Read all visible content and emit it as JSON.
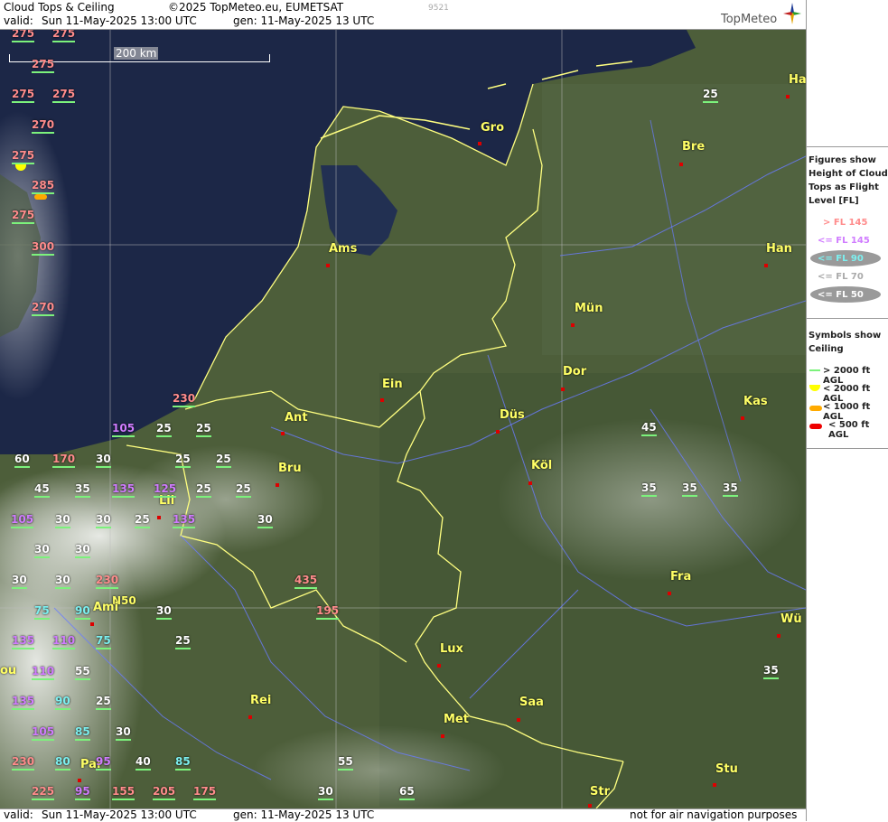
{
  "header": {
    "title": "Cloud Tops & Ceiling",
    "copyright": "©2025 TopMeteo.eu, EUMETSAT",
    "code": "9521",
    "valid_label": "valid:",
    "valid_time": "Sun  11-May-2025  13:00 UTC",
    "gen_time": "gen: 11-May-2025 13 UTC",
    "brand": "TopMeteo"
  },
  "footer": {
    "valid_label": "valid:",
    "valid_time": "Sun  11-May-2025  13:00 UTC",
    "gen_time": "gen: 11-May-2025 13 UTC",
    "disclaimer": "not for air navigation purposes"
  },
  "map": {
    "scale_label": "200 km",
    "region_label": "N50",
    "cities": [
      {
        "name": "Gro"
      },
      {
        "name": "Bre"
      },
      {
        "name": "Ha"
      },
      {
        "name": "Ams"
      },
      {
        "name": "Han"
      },
      {
        "name": "Mün"
      },
      {
        "name": "Dor"
      },
      {
        "name": "Ein"
      },
      {
        "name": "Ant"
      },
      {
        "name": "Düs"
      },
      {
        "name": "Kas"
      },
      {
        "name": "Bru"
      },
      {
        "name": "Köl"
      },
      {
        "name": "Lil"
      },
      {
        "name": "Ami"
      },
      {
        "name": "Fra"
      },
      {
        "name": "Wü"
      },
      {
        "name": "Lux"
      },
      {
        "name": "Rei"
      },
      {
        "name": "Saa"
      },
      {
        "name": "Met"
      },
      {
        "name": "Stu"
      },
      {
        "name": "Par"
      },
      {
        "name": "Str"
      },
      {
        "name": "ou"
      }
    ],
    "flight_levels": [
      {
        "v": "275",
        "c": "pink"
      },
      {
        "v": "275",
        "c": "pink"
      },
      {
        "v": "275",
        "c": "pink"
      },
      {
        "v": "275",
        "c": "pink"
      },
      {
        "v": "275",
        "c": "pink"
      },
      {
        "v": "270",
        "c": "pink"
      },
      {
        "v": "275",
        "c": "pink"
      },
      {
        "v": "285",
        "c": "pink"
      },
      {
        "v": "275",
        "c": "pink"
      },
      {
        "v": "300",
        "c": "pink"
      },
      {
        "v": "270",
        "c": "pink"
      },
      {
        "v": "25",
        "c": "white"
      },
      {
        "v": "230",
        "c": "pink"
      },
      {
        "v": "105",
        "c": "purple"
      },
      {
        "v": "25",
        "c": "white"
      },
      {
        "v": "25",
        "c": "white"
      },
      {
        "v": "60",
        "c": "white"
      },
      {
        "v": "170",
        "c": "pink"
      },
      {
        "v": "30",
        "c": "white"
      },
      {
        "v": "25",
        "c": "white"
      },
      {
        "v": "25",
        "c": "white"
      },
      {
        "v": "45",
        "c": "white"
      },
      {
        "v": "35",
        "c": "white"
      },
      {
        "v": "135",
        "c": "purple"
      },
      {
        "v": "125",
        "c": "purple"
      },
      {
        "v": "25",
        "c": "white"
      },
      {
        "v": "25",
        "c": "white"
      },
      {
        "v": "105",
        "c": "purple"
      },
      {
        "v": "30",
        "c": "white"
      },
      {
        "v": "30",
        "c": "white"
      },
      {
        "v": "25",
        "c": "white"
      },
      {
        "v": "135",
        "c": "purple"
      },
      {
        "v": "30",
        "c": "white"
      },
      {
        "v": "30",
        "c": "white"
      },
      {
        "v": "30",
        "c": "white"
      },
      {
        "v": "230",
        "c": "pink"
      },
      {
        "v": "30",
        "c": "white"
      },
      {
        "v": "30",
        "c": "white"
      },
      {
        "v": "435",
        "c": "pink"
      },
      {
        "v": "75",
        "c": "cyan"
      },
      {
        "v": "90",
        "c": "cyan"
      },
      {
        "v": "30",
        "c": "white"
      },
      {
        "v": "195",
        "c": "pink"
      },
      {
        "v": "135",
        "c": "purple"
      },
      {
        "v": "110",
        "c": "purple"
      },
      {
        "v": "75",
        "c": "cyan"
      },
      {
        "v": "25",
        "c": "white"
      },
      {
        "v": "110",
        "c": "purple"
      },
      {
        "v": "55",
        "c": "white"
      },
      {
        "v": "135",
        "c": "purple"
      },
      {
        "v": "90",
        "c": "cyan"
      },
      {
        "v": "25",
        "c": "white"
      },
      {
        "v": "105",
        "c": "purple"
      },
      {
        "v": "85",
        "c": "cyan"
      },
      {
        "v": "30",
        "c": "white"
      },
      {
        "v": "230",
        "c": "pink"
      },
      {
        "v": "80",
        "c": "cyan"
      },
      {
        "v": "95",
        "c": "purple"
      },
      {
        "v": "40",
        "c": "white"
      },
      {
        "v": "85",
        "c": "cyan"
      },
      {
        "v": "55",
        "c": "white"
      },
      {
        "v": "225",
        "c": "pink"
      },
      {
        "v": "95",
        "c": "purple"
      },
      {
        "v": "155",
        "c": "pink"
      },
      {
        "v": "205",
        "c": "pink"
      },
      {
        "v": "175",
        "c": "pink"
      },
      {
        "v": "30",
        "c": "white"
      },
      {
        "v": "65",
        "c": "white"
      },
      {
        "v": "45",
        "c": "white"
      },
      {
        "v": "35",
        "c": "white"
      },
      {
        "v": "35",
        "c": "white"
      },
      {
        "v": "35",
        "c": "white"
      },
      {
        "v": "35",
        "c": "white"
      }
    ]
  },
  "legend": {
    "heading1": "Figures show Height of Cloud Tops as Flight Level  [FL]",
    "fl_items": [
      {
        "label": "> FL 145",
        "color": "#ff8c8c"
      },
      {
        "label": "<= FL 145",
        "color": "#d07cff"
      },
      {
        "label": "<= FL 90",
        "color": "#7cf0f0"
      },
      {
        "label": "<= FL 70",
        "color": "#aaaaaa"
      },
      {
        "label": "<= FL 50",
        "color": "#ffffff"
      }
    ],
    "heading2": "Symbols show Ceiling",
    "sym_items": [
      {
        "label": "> 2000 ft AGL",
        "color": "#7cf27c"
      },
      {
        "label": "< 2000 ft AGL",
        "color": "#ffff00"
      },
      {
        "label": "< 1000 ft AGL",
        "color": "#ffaa00"
      },
      {
        "label": "< 500 ft AGL",
        "color": "#ee0000"
      }
    ]
  }
}
